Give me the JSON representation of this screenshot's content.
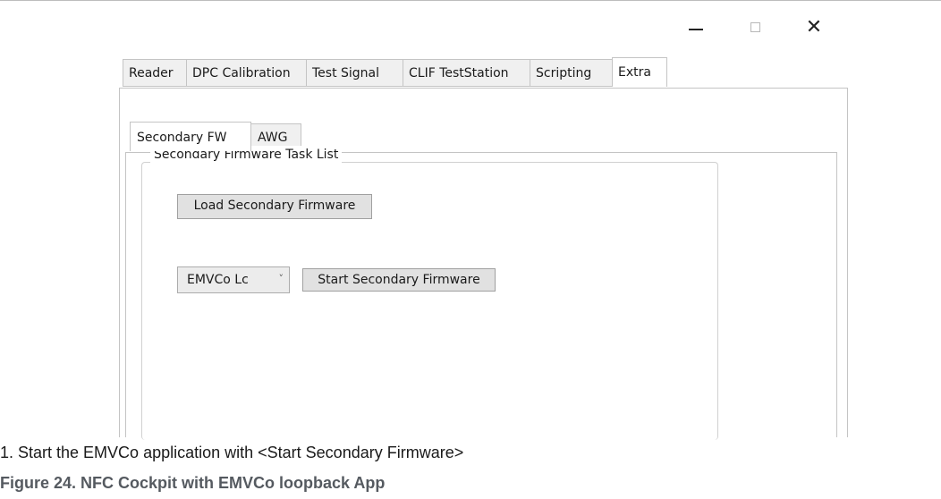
{
  "window": {
    "minimize_icon": "minimize-icon",
    "maximize_icon": "maximize-icon",
    "close_glyph": "✕"
  },
  "tabs": [
    "Reader",
    "DPC Calibration",
    "Test Signal",
    "CLIF TestStation",
    "Scripting",
    "Extra"
  ],
  "active_tab": "Extra",
  "subtabs": [
    "Secondary FW",
    "AWG"
  ],
  "active_subtab": "Secondary FW",
  "group": {
    "title": "Secondary Firmware Task List",
    "load_button": "Load Secondary Firmware",
    "app_select_value": "EMVCo Lc",
    "app_select_chevron": "˅",
    "start_button": "Start Secondary Firmware"
  },
  "step_text": "1.  Start the EMVCo application with <Start Secondary Firmware>",
  "caption": "Figure 24.  NFC Cockpit with EMVCo loopback App"
}
